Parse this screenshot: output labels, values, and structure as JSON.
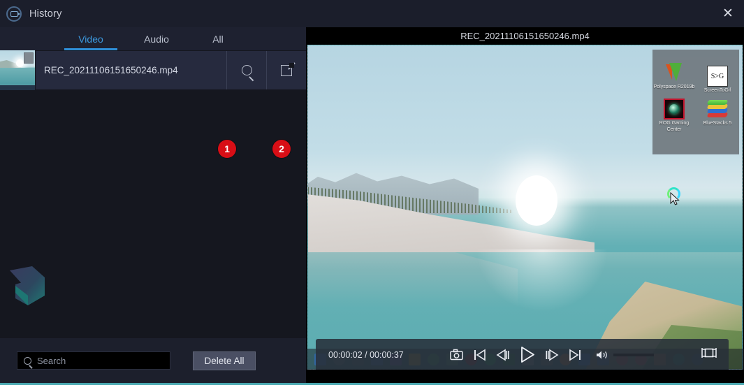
{
  "window": {
    "title": "History",
    "app_icon": "history-camera-icon",
    "close_label": "✕"
  },
  "tabs": [
    {
      "id": "video",
      "label": "Video",
      "active": true
    },
    {
      "id": "audio",
      "label": "Audio",
      "active": false
    },
    {
      "id": "all",
      "label": "All",
      "active": false
    }
  ],
  "list": {
    "rows": [
      {
        "filename": "REC_20211106151650246.mp4",
        "open_location_icon": "magnifier-icon",
        "edit_icon": "edit-square-icon"
      }
    ]
  },
  "annotations": [
    {
      "id": "badge-1",
      "label": "1"
    },
    {
      "id": "badge-2",
      "label": "2"
    }
  ],
  "search": {
    "value": "",
    "placeholder": "Search",
    "icon": "search-icon"
  },
  "actions": {
    "delete_all_label": "Delete All"
  },
  "player": {
    "title": "REC_20211106151650246.mp4",
    "current_time": "00:00:02",
    "total_time": "00:00:37",
    "timecode": "00:00:02 / 00:00:37",
    "progress_percent": 6,
    "volume_percent": 45,
    "is_playing": false,
    "buttons": [
      {
        "name": "snapshot-icon",
        "title": "Snapshot"
      },
      {
        "name": "skip-previous-icon",
        "title": "Previous"
      },
      {
        "name": "step-backward-icon",
        "title": "Step backward"
      },
      {
        "name": "play-icon",
        "title": "Play"
      },
      {
        "name": "step-forward-icon",
        "title": "Step forward"
      },
      {
        "name": "skip-next-icon",
        "title": "Next"
      },
      {
        "name": "volume-icon",
        "title": "Volume"
      },
      {
        "name": "fullscreen-icon",
        "title": "Fullscreen"
      }
    ]
  },
  "video_scene": {
    "desktop_icons": [
      {
        "label": "Polyspace R2019b",
        "icon": "polyspace-icon"
      },
      {
        "label": "ScreenToGif",
        "icon": "screentogif-icon",
        "glyph": "S>G"
      },
      {
        "label": "ROG Gaming Center",
        "icon": "rog-gaming-center-icon"
      },
      {
        "label": "BlueStacks 5",
        "icon": "bluestacks-icon"
      }
    ],
    "cursor": "arrow-cursor-with-busy-spinner"
  },
  "colors": {
    "accent_blue": "#2f8fd8",
    "badge_red": "#d80e16",
    "progress_blue": "#18a0e0",
    "panel_bg": "#15171f",
    "titlebar_bg": "#1b1e2b",
    "row_selected": "#262a3e",
    "bottom_border_teal": "#4aa8b0"
  }
}
